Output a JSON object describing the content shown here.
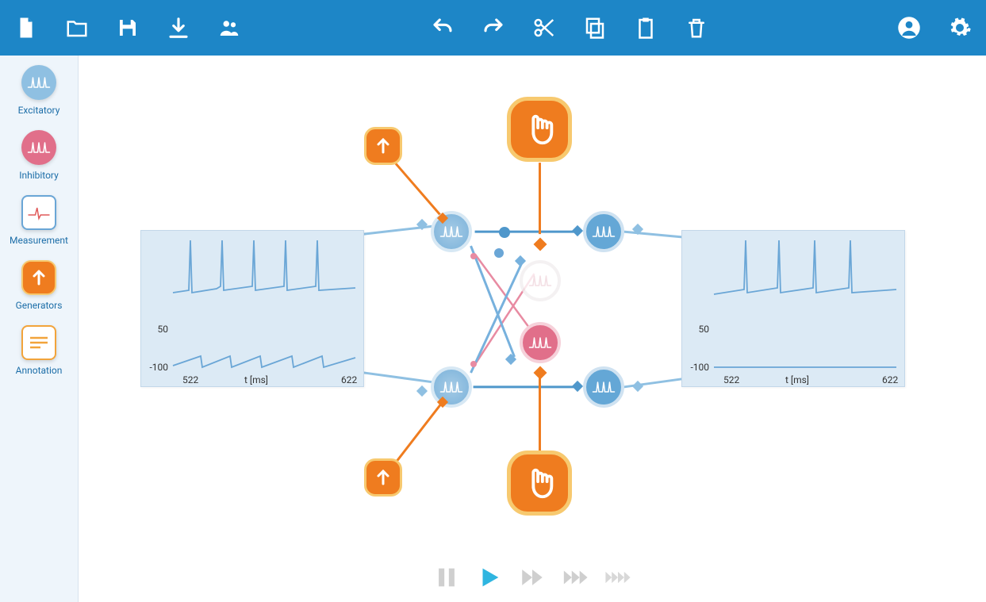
{
  "toolbar": {
    "new": "New",
    "open": "Open",
    "save": "Save",
    "download": "Download",
    "share": "Share",
    "undo": "Undo",
    "redo": "Redo",
    "cut": "Cut",
    "copy": "Copy",
    "paste": "Paste",
    "delete": "Delete",
    "account": "Account",
    "settings": "Settings"
  },
  "sidebar": {
    "items": [
      {
        "label": "Excitatory",
        "icon": "spike-icon",
        "style": "blue-circle"
      },
      {
        "label": "Inhibitory",
        "icon": "spike-icon",
        "style": "pink-circle"
      },
      {
        "label": "Measurement",
        "icon": "pulse-icon",
        "style": "square-blue"
      },
      {
        "label": "Generators",
        "icon": "arrow-up-icon",
        "style": "orange-square"
      },
      {
        "label": "Annotation",
        "icon": "text-lines-icon",
        "style": "square-orange"
      }
    ]
  },
  "playback": {
    "pause": "Pause",
    "play": "Play",
    "fast": "Fast",
    "faster": "Faster",
    "fastest": "Fastest",
    "active": "play"
  },
  "plots": {
    "left": {
      "y_hi": "50",
      "y_lo": "-100",
      "x_lo": "522",
      "x_hi": "622",
      "x_label": "t [ms]"
    },
    "right": {
      "y_hi": "50",
      "y_lo": "-100",
      "x_lo": "522",
      "x_hi": "622",
      "x_label": "t [ms]"
    }
  },
  "colors": {
    "brand": "#1d86c7",
    "excitatory": "#64a7d6",
    "inhibitory": "#e16f8a",
    "generator": "#ef7c1f",
    "generator_ring": "#f7c96f",
    "plot_bg": "#dceaf5",
    "plot_line": "#7bb2da"
  },
  "chart_data": [
    {
      "type": "line",
      "title": "",
      "xlabel": "t [ms]",
      "ylabel": "",
      "xlim": [
        522,
        622
      ],
      "ylim": [
        -100,
        50
      ],
      "series": [
        {
          "name": "trace_top",
          "description": "membrane potential with 5 spikes, baseline ~ -55",
          "baseline": -55,
          "spike_value": 50,
          "spike_times_ms": [
            532,
            552,
            572,
            592,
            612
          ]
        },
        {
          "name": "trace_bottom",
          "description": "subthreshold sawtooth ramp between ~ -100 and ~ -85",
          "min": -100,
          "max": -85,
          "period_ms": 25
        }
      ]
    },
    {
      "type": "line",
      "title": "",
      "xlabel": "t [ms]",
      "ylabel": "",
      "xlim": [
        522,
        622
      ],
      "ylim": [
        -100,
        50
      ],
      "series": [
        {
          "name": "trace_top",
          "description": "membrane potential with 4 spikes, baseline ~ -55",
          "baseline": -55,
          "spike_value": 50,
          "spike_times_ms": [
            545,
            567,
            589,
            611
          ]
        },
        {
          "name": "trace_bottom",
          "description": "flat line at ~ -98",
          "value": -98
        }
      ]
    }
  ]
}
